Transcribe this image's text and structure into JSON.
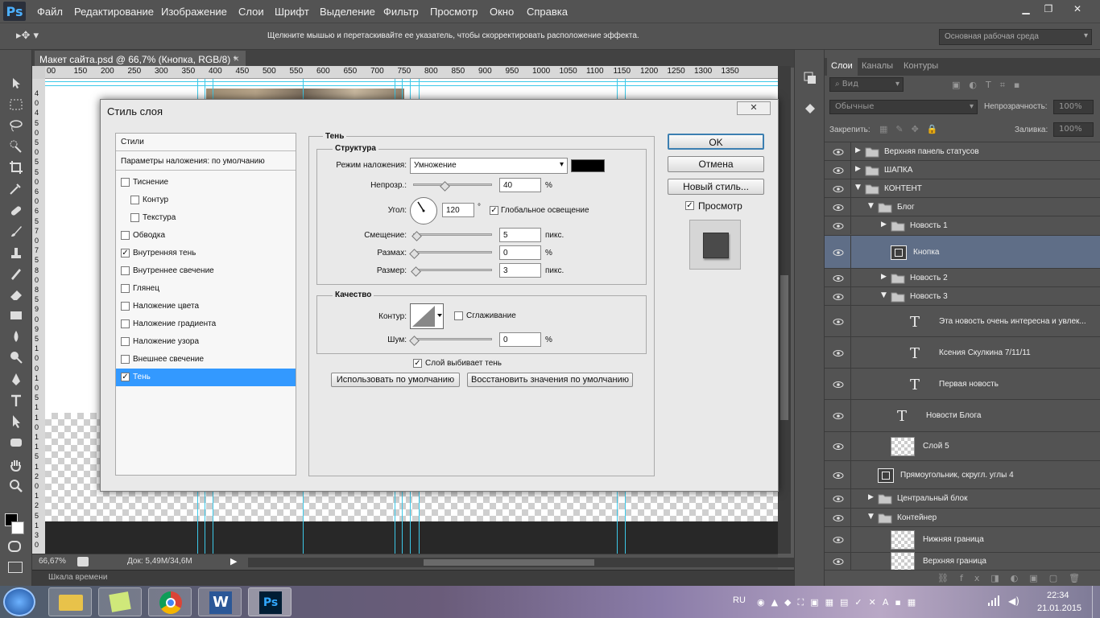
{
  "app": {
    "logo": "Ps"
  },
  "menu": [
    "Файл",
    "Редактирование",
    "Изображение",
    "Слои",
    "Шрифт",
    "Выделение",
    "Фильтр",
    "Просмотр",
    "Окно",
    "Справка"
  ],
  "options": {
    "hint": "Щелкните мышью и перетаскивайте ее указатель, чтобы скорректировать расположение эффекта.",
    "workspace": "Основная рабочая среда"
  },
  "document": {
    "tab_title": "Макет сайта.psd @ 66,7% (Кнопка, RGB/8) *",
    "close": "×"
  },
  "ruler_top": [
    "00",
    "150",
    "200",
    "250",
    "300",
    "350",
    "400",
    "450",
    "500",
    "550",
    "600",
    "650",
    "700",
    "750",
    "800",
    "850",
    "900",
    "950",
    "1000",
    "1050",
    "1100",
    "1150",
    "1200",
    "1250",
    "1300",
    "1350"
  ],
  "ruler_left": [
    "4",
    "0",
    "4",
    "5",
    "0",
    "5",
    "0",
    "5",
    "5",
    "0",
    "6",
    "0",
    "6",
    "5",
    "7",
    "0",
    "7",
    "5",
    "8",
    "0",
    "8",
    "5",
    "9",
    "0",
    "9",
    "5",
    "1",
    "0",
    "0",
    "1",
    "0",
    "5",
    "1",
    "1",
    "0",
    "1",
    "1",
    "5",
    "1",
    "2",
    "0",
    "1",
    "2",
    "5",
    "1",
    "3",
    "0"
  ],
  "status": {
    "zoom": "66,67%",
    "doc": "Док: 5,49M/34,6M"
  },
  "timeline": {
    "label": "Шкала времени"
  },
  "dialog": {
    "title": "Стиль слоя",
    "styles_header": "Стили",
    "blend_default": "Параметры наложения: по умолчанию",
    "style_items": [
      {
        "label": "Тиснение",
        "checked": false,
        "indent": false
      },
      {
        "label": "Контур",
        "checked": false,
        "indent": true
      },
      {
        "label": "Текстура",
        "checked": false,
        "indent": true
      },
      {
        "label": "Обводка",
        "checked": false,
        "indent": false
      },
      {
        "label": "Внутренняя тень",
        "checked": true,
        "indent": false
      },
      {
        "label": "Внутреннее свечение",
        "checked": false,
        "indent": false
      },
      {
        "label": "Глянец",
        "checked": false,
        "indent": false
      },
      {
        "label": "Наложение цвета",
        "checked": false,
        "indent": false
      },
      {
        "label": "Наложение градиента",
        "checked": false,
        "indent": false
      },
      {
        "label": "Наложение узора",
        "checked": false,
        "indent": false
      },
      {
        "label": "Внешнее свечение",
        "checked": false,
        "indent": false
      },
      {
        "label": "Тень",
        "checked": true,
        "indent": false
      }
    ],
    "section": "Тень",
    "structure": "Структура",
    "blend_mode_label": "Режим наложения:",
    "blend_mode": "Умножение",
    "shadow_color": "#000000",
    "opacity_label": "Непрозр.:",
    "opacity": "40",
    "opacity_pct": 0.4,
    "opacity_unit": "%",
    "angle_label": "Угол:",
    "angle": "120",
    "angle_unit": "°",
    "global_light": "Глобальное освещение",
    "global_light_checked": true,
    "distance_label": "Смещение:",
    "distance": "5",
    "spread_label": "Размах:",
    "spread": "0",
    "size_label": "Размер:",
    "size": "3",
    "px_unit": "пикс.",
    "pct_unit": "%",
    "quality": "Качество",
    "contour_label": "Контур:",
    "antialias": "Сглаживание",
    "noise_label": "Шум:",
    "noise": "0",
    "knocks_out": "Слой выбивает тень",
    "use_default": "Использовать по умолчанию",
    "reset_default": "Восстановить значения по умолчанию",
    "ok": "OK",
    "cancel": "Отмена",
    "new_style": "Новый стиль...",
    "preview": "Просмотр"
  },
  "panel": {
    "tabs": [
      "Слои",
      "Каналы",
      "Контуры"
    ],
    "kind": "Вид",
    "blend": "Обычные",
    "opacity_label": "Непрозрачность:",
    "opacity": "100%",
    "lock_label": "Закрепить:",
    "fill_label": "Заливка:",
    "fill": "100%",
    "layers": [
      {
        "name": "Верхняя панель статусов",
        "type": "folder",
        "level": 0,
        "open": false
      },
      {
        "name": "ШАПКА",
        "type": "folder",
        "level": 0,
        "open": false
      },
      {
        "name": "КОНТЕНТ",
        "type": "folder",
        "level": 0,
        "open": true
      },
      {
        "name": "Блог",
        "type": "folder",
        "level": 1,
        "open": true
      },
      {
        "name": "Новость 1",
        "type": "folder",
        "level": 2,
        "open": false
      },
      {
        "name": "Кнопка",
        "type": "shape",
        "level": 2,
        "selected": true
      },
      {
        "name": "Новость 2",
        "type": "folder",
        "level": 2,
        "open": false
      },
      {
        "name": "Новость 3",
        "type": "folder",
        "level": 2,
        "open": true
      },
      {
        "name": "Эта новость очень интересна и увлек...",
        "type": "text",
        "level": 3
      },
      {
        "name": "Ксения Скулкина   7/11/11",
        "type": "text",
        "level": 3
      },
      {
        "name": "Первая новость",
        "type": "text",
        "level": 3
      },
      {
        "name": "Новости Блога",
        "type": "text",
        "level": 2
      },
      {
        "name": "Слой 5",
        "type": "raster",
        "level": 2
      },
      {
        "name": "Прямоугольник, скругл. углы 4",
        "type": "shape",
        "level": 1
      },
      {
        "name": "Центральный блок",
        "type": "folder",
        "level": 1,
        "open": false
      },
      {
        "name": "Контейнер",
        "type": "folder",
        "level": 1,
        "open": true
      },
      {
        "name": "Нижняя граница",
        "type": "raster",
        "level": 2
      },
      {
        "name": "Верхняя граница",
        "type": "raster",
        "level": 2
      }
    ]
  },
  "taskbar": {
    "lang": "RU",
    "time": "22:34",
    "date": "21.01.2015"
  }
}
